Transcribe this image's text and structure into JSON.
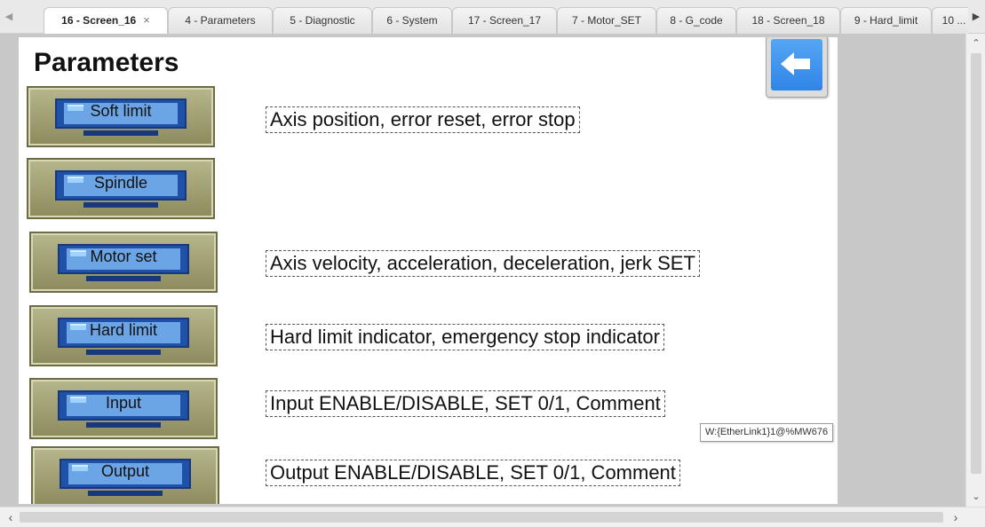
{
  "tabs": [
    {
      "label": "16 - Screen_16",
      "active": true,
      "closable": true
    },
    {
      "label": "4 - Parameters"
    },
    {
      "label": "5 - Diagnostic"
    },
    {
      "label": "6 - System"
    },
    {
      "label": "17 - Screen_17"
    },
    {
      "label": "7 - Motor_SET"
    },
    {
      "label": "8 - G_code"
    },
    {
      "label": "18 - Screen_18"
    },
    {
      "label": "9 - Hard_limit"
    },
    {
      "label": "10 ..."
    }
  ],
  "tab_close_glyph": "×",
  "screen": {
    "title": "Parameters",
    "back_icon": "arrow-left-icon",
    "buttons": [
      {
        "label": "Soft limit",
        "description": "Axis position, error reset, error stop"
      },
      {
        "label": "Spindle",
        "description": ""
      },
      {
        "label": "Motor set",
        "description": "Axis velocity, acceleration, deceleration, jerk SET"
      },
      {
        "label": "Hard limit",
        "description": "Hard limit indicator, emergency stop indicator"
      },
      {
        "label": "Input",
        "description": "Input ENABLE/DISABLE, SET 0/1, Comment"
      },
      {
        "label": "Output",
        "description": "Output ENABLE/DISABLE, SET 0/1, Comment"
      }
    ]
  },
  "tooltip": "W:{EtherLink1}1@%MW676",
  "colors": {
    "button_face": "#a3a275",
    "monitor": "#1f51a8",
    "back_button": "#3a8ef0"
  }
}
